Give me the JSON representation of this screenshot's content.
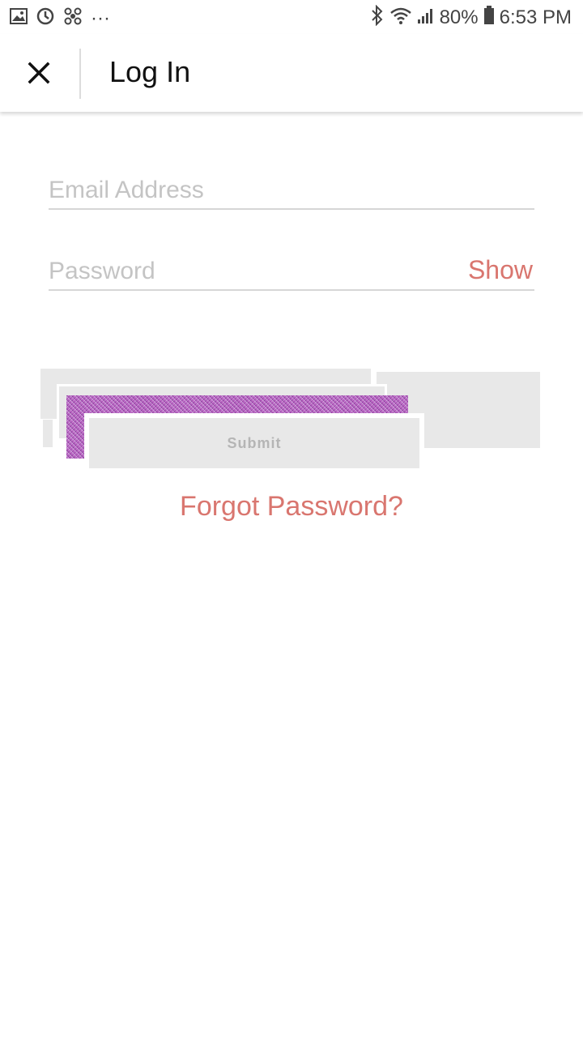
{
  "status_bar": {
    "icons_left": [
      "gallery-icon",
      "sync-icon",
      "fan-icon",
      "more-dots-icon"
    ],
    "more_label": "···",
    "battery": "80%",
    "time": "6:53 PM"
  },
  "header": {
    "title": "Log In"
  },
  "form": {
    "email_placeholder": "Email Address",
    "password_placeholder": "Password",
    "show_label": "Show",
    "submit_label": "Submit",
    "forgot_label": "Forgot Password?"
  },
  "colors": {
    "accent": "#d9766f",
    "button_bg": "#e8e8e8",
    "placeholder": "#c4c4c4"
  }
}
